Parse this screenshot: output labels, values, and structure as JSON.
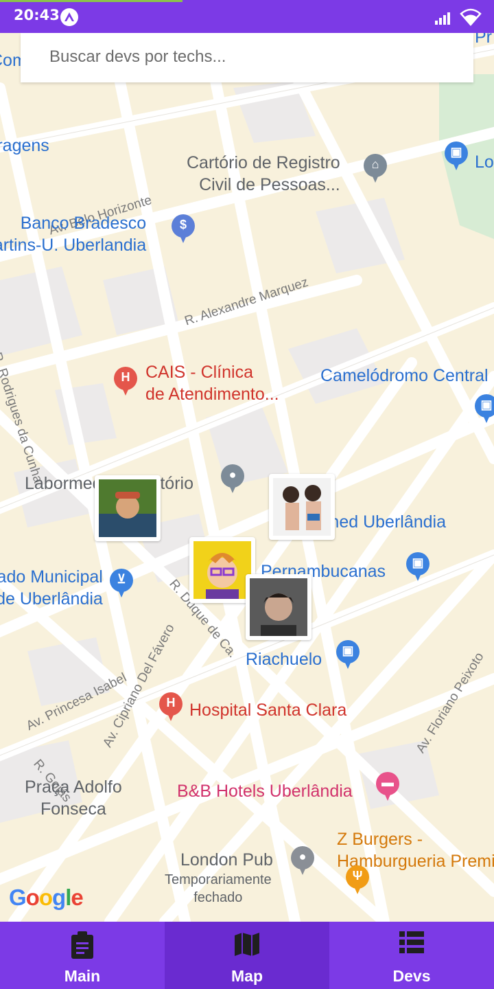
{
  "status_bar": {
    "time": "20:43"
  },
  "search": {
    "placeholder": "Buscar devs por techs..."
  },
  "map": {
    "places": {
      "cartorio": "Cartório de Registro\nCivil de Pessoas...",
      "banco": "Banco Bradesco\nMartins-U. Uberlandia",
      "cais": "CAIS - Clínica\nde Atendimento...",
      "camelodromo": "Camelódromo Central",
      "labormed": "Labormed Laboratório",
      "unimed": "Unimed Uberlândia",
      "mercado": "Mercado Municipal\nde Uberlândia",
      "pernambucanas": "Pernambucanas",
      "riachuelo": "Riachuelo",
      "hospital": "Hospital Santa Clara",
      "praca": "Praça Adolfo\nFonseca",
      "bb_hotels": "B&B Hotels Uberlândia",
      "z_burgers": "Z Burgers -\nHamburgueria Premium",
      "london_pub": "London Pub",
      "london_pub_status": "Temporariamente\nfechado",
      "garagens": "Garagens",
      "cio": "Comercio",
      "lo": "Lo",
      "pr": "Pr"
    },
    "streets": {
      "belo_horizonte": "Av. Belo Horizonte",
      "alexandre": "R. Alexandre Marquez",
      "rodrigues": "R. Rodrigues da Cunha",
      "duque": "R. Duque de Ca.",
      "princesa": "Av. Princesa Isabel",
      "cipriano": "Av. Cipriano Del Fávero",
      "floriano": "Av. Floriano Peixoto",
      "goias": "R. Goiás"
    },
    "attribution": "Google",
    "dev_markers": [
      "dev-avatar-1",
      "dev-avatar-2",
      "dev-avatar-3",
      "dev-avatar-4"
    ]
  },
  "nav": {
    "tabs": [
      {
        "label": "Main",
        "icon": "clipboard-icon",
        "active": false
      },
      {
        "label": "Map",
        "icon": "map-icon",
        "active": true
      },
      {
        "label": "Devs",
        "icon": "list-icon",
        "active": false
      }
    ]
  },
  "colors": {
    "accent": "#7c3ae6",
    "accent_dark": "#6a2bd0",
    "map_land": "#f8f1dc",
    "road": "#ffffff"
  }
}
